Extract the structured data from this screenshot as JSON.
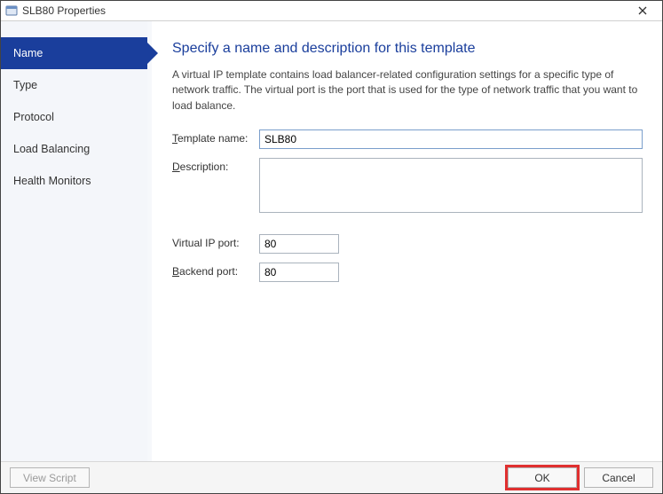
{
  "window": {
    "title": "SLB80 Properties"
  },
  "sidebar": {
    "items": [
      {
        "label": "Name",
        "active": true
      },
      {
        "label": "Type"
      },
      {
        "label": "Protocol"
      },
      {
        "label": "Load Balancing"
      },
      {
        "label": "Health Monitors"
      }
    ]
  },
  "content": {
    "heading": "Specify a name and description for this template",
    "intro": "A virtual IP template contains load balancer-related configuration settings for a specific type of network traffic. The virtual port is the port that is used for the type of network traffic that you want to load balance.",
    "labels": {
      "template_name_pre": "T",
      "template_name_rest": "emplate name:",
      "description_pre": "D",
      "description_rest": "escription:",
      "vip_port": "Virtual IP port:",
      "backend_port_pre": "B",
      "backend_port_rest": "ackend port:"
    },
    "values": {
      "template_name": "SLB80",
      "description": "",
      "vip_port": "80",
      "backend_port": "80"
    }
  },
  "footer": {
    "view_script": "View Script",
    "ok": "OK",
    "cancel": "Cancel"
  }
}
